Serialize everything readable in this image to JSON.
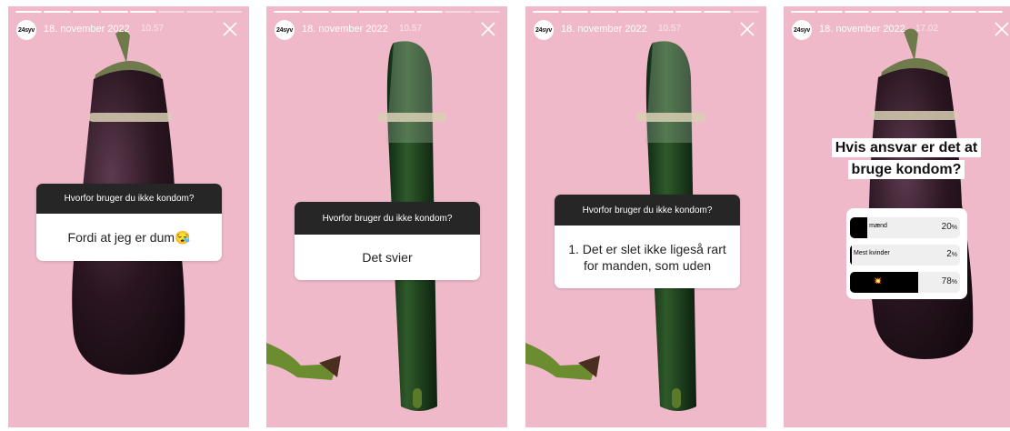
{
  "stories": [
    {
      "date": "18. november 2022",
      "time": "10.57",
      "question": "Hvorfor bruger du ikke kondom?",
      "answer": "Fordi at jeg er dum😪",
      "progress_segments": [
        1,
        1,
        1,
        1,
        1,
        0,
        0,
        0
      ]
    },
    {
      "date": "18. november 2022",
      "time": "10.57",
      "question": "Hvorfor bruger du ikke kondom?",
      "answer": "Det svier",
      "progress_segments": [
        1,
        1,
        1,
        1,
        1,
        1,
        0,
        0
      ]
    },
    {
      "date": "18. november 2022",
      "time": "10.57",
      "question": "Hvorfor bruger du ikke kondom?",
      "answer": "1. Det er slet ikke ligeså rart for manden, som uden",
      "progress_segments": [
        1,
        1,
        1,
        1,
        1,
        1,
        1,
        0
      ]
    },
    {
      "date": "18. november 2022",
      "time": "17.02",
      "poll": {
        "title": "Hvis ansvar er det at bruge kondom?",
        "options": [
          {
            "label": "Mest mænd",
            "percent": 20
          },
          {
            "label": "Mest kvinder",
            "percent": 2
          },
          {
            "label": "Begge 💥",
            "percent": 78
          }
        ]
      },
      "progress_segments": [
        1,
        1,
        1,
        1,
        1,
        1,
        1,
        1
      ]
    }
  ],
  "account": {
    "logo_text": "24syv"
  },
  "icons": {
    "close": "close-icon"
  },
  "colors": {
    "background": "#efb9c9",
    "question_bar": "#262626",
    "poll_fill": "#000000"
  }
}
